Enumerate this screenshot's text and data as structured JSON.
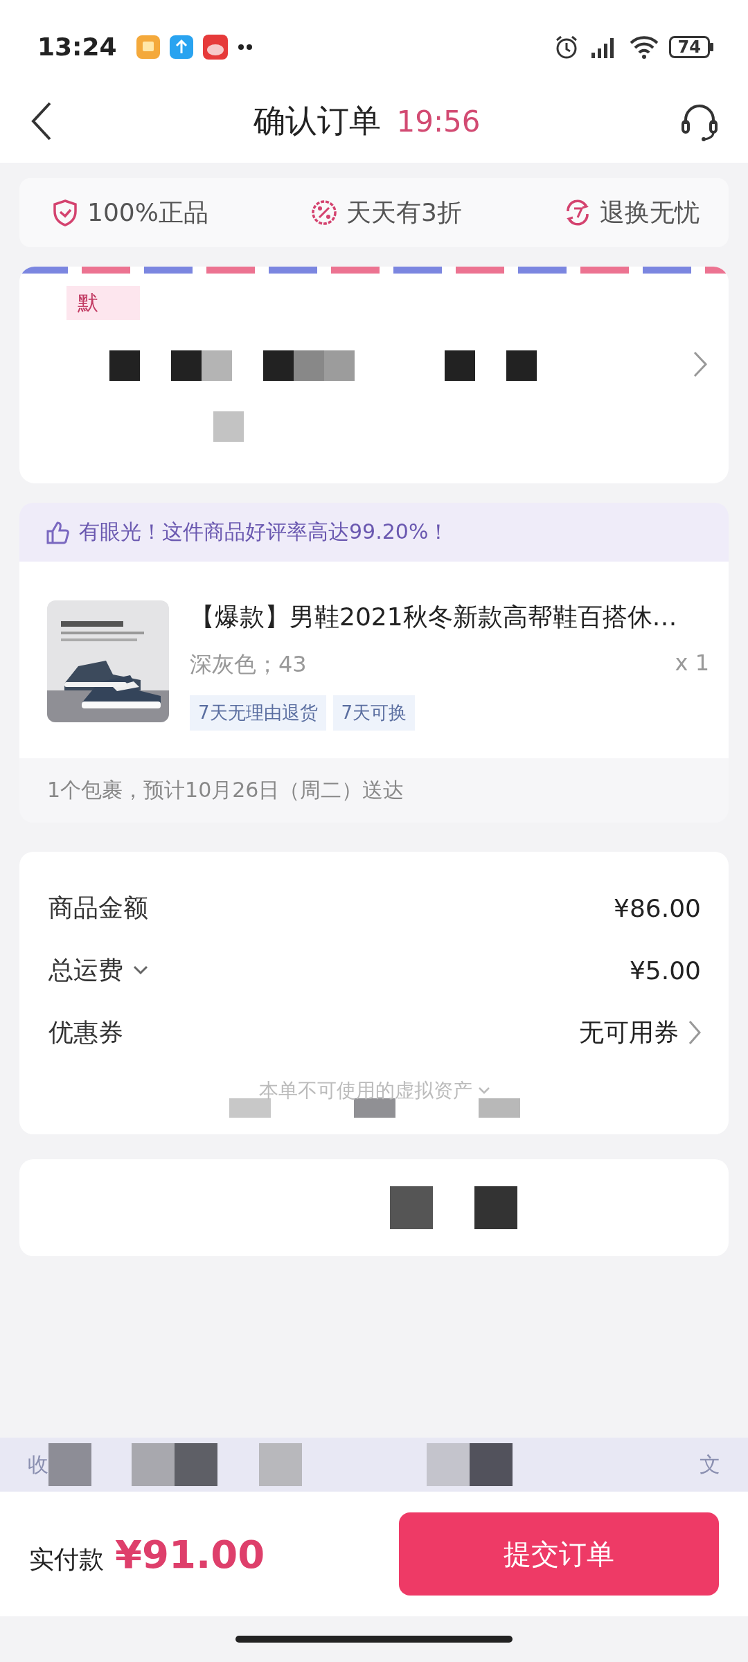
{
  "status_bar": {
    "time": "13:24",
    "battery": "74"
  },
  "header": {
    "title": "确认订单",
    "countdown": "19:56"
  },
  "guarantees": [
    {
      "label": "100%正品",
      "kind": "shield"
    },
    {
      "label": "天天有3折",
      "kind": "discount"
    },
    {
      "label": "退换无忧",
      "kind": "return"
    }
  ],
  "address": {
    "tag": "默"
  },
  "hint": "有眼光！这件商品好评率高达99.20%！",
  "product": {
    "title": "【爆款】男鞋2021秋冬新款高帮鞋百搭休…",
    "spec": "深灰色；43",
    "quantity": "x 1",
    "tags": [
      "7天无理由退货",
      "7天可换"
    ]
  },
  "delivery": "1个包裹，预计10月26日（周二）送达",
  "price_rows": [
    {
      "label": "商品金额",
      "value": "¥86.00",
      "kind": "plain"
    },
    {
      "label": "总运费",
      "value": "¥5.00",
      "kind": "dropdown"
    },
    {
      "label": "优惠券",
      "value": "无可用券",
      "kind": "link"
    }
  ],
  "assets_note": "本单不可使用的虚拟资产",
  "notice": {
    "left": "收",
    "right": "文"
  },
  "footer": {
    "total_label": "实付款",
    "total": "¥91.00",
    "submit": "提交订单"
  }
}
